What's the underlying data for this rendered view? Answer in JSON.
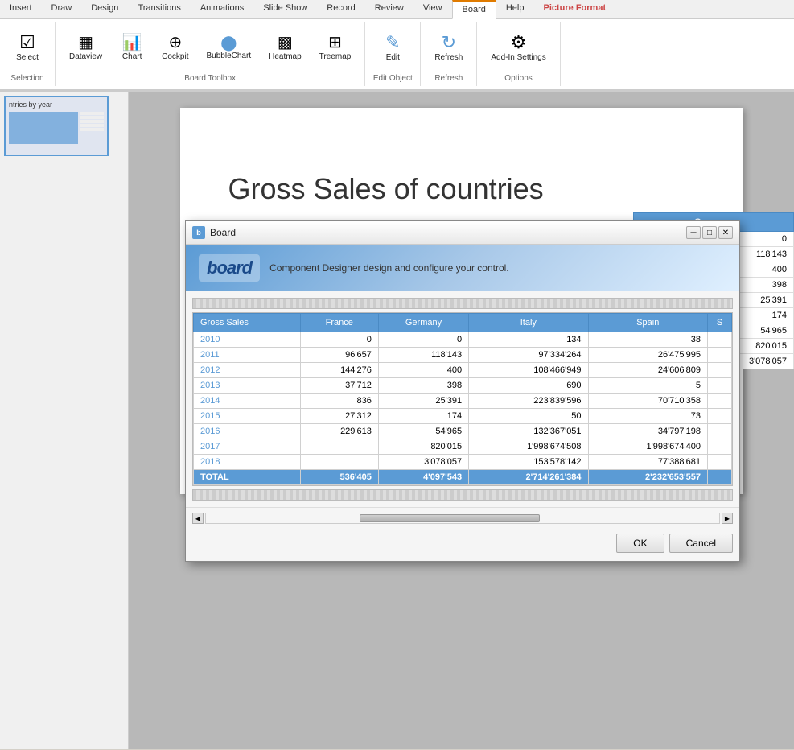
{
  "ribbon": {
    "tabs": [
      {
        "label": "Insert",
        "active": false
      },
      {
        "label": "Draw",
        "active": false
      },
      {
        "label": "Design",
        "active": false
      },
      {
        "label": "Transitions",
        "active": false
      },
      {
        "label": "Animations",
        "active": false
      },
      {
        "label": "Slide Show",
        "active": false
      },
      {
        "label": "Record",
        "active": false
      },
      {
        "label": "Review",
        "active": false
      },
      {
        "label": "View",
        "active": false
      },
      {
        "label": "Board",
        "active": true
      },
      {
        "label": "Help",
        "active": false
      },
      {
        "label": "Picture Format",
        "active": false,
        "highlight": true
      }
    ],
    "groups": {
      "selection": {
        "label": "Selection",
        "buttons": [
          {
            "label": "Select",
            "icon": "☑"
          }
        ]
      },
      "toolbox": {
        "label": "Board Toolbox",
        "buttons": [
          {
            "label": "Dataview",
            "icon": "▦"
          },
          {
            "label": "Chart",
            "icon": "📊"
          },
          {
            "label": "Cockpit",
            "icon": "⊕"
          },
          {
            "label": "BubbleChart",
            "icon": "⬤"
          },
          {
            "label": "Heatmap",
            "icon": "▩"
          },
          {
            "label": "Treemap",
            "icon": "▪"
          }
        ]
      },
      "editobject": {
        "label": "Edit Object",
        "buttons": [
          {
            "label": "Edit",
            "icon": "✎"
          }
        ]
      },
      "refresh": {
        "label": "Refresh",
        "buttons": [
          {
            "label": "Refresh",
            "icon": "↻"
          }
        ]
      },
      "options": {
        "label": "Options",
        "buttons": [
          {
            "label": "Add-In Settings",
            "icon": "⚙"
          }
        ]
      }
    }
  },
  "modal": {
    "title": "Board",
    "header_text": "Component Designer design and configure your control.",
    "logo_text": "board",
    "table": {
      "columns": [
        "Gross Sales",
        "France",
        "Germany",
        "Italy",
        "Spain",
        "S"
      ],
      "rows": [
        {
          "label": "2010",
          "france": "0",
          "germany": "0",
          "italy": "134",
          "spain": "38",
          "s": ""
        },
        {
          "label": "2011",
          "france": "96'657",
          "germany": "118'143",
          "italy": "97'334'264",
          "spain": "26'475'995",
          "s": ""
        },
        {
          "label": "2012",
          "france": "144'276",
          "germany": "400",
          "italy": "108'466'949",
          "spain": "24'606'809",
          "s": ""
        },
        {
          "label": "2013",
          "france": "37'712",
          "germany": "398",
          "italy": "690",
          "spain": "5",
          "s": ""
        },
        {
          "label": "2014",
          "france": "836",
          "germany": "25'391",
          "italy": "223'839'596",
          "spain": "70'710'358",
          "s": ""
        },
        {
          "label": "2015",
          "france": "27'312",
          "germany": "174",
          "italy": "50",
          "spain": "73",
          "s": ""
        },
        {
          "label": "2016",
          "france": "229'613",
          "germany": "54'965",
          "italy": "132'367'051",
          "spain": "34'797'198",
          "s": ""
        },
        {
          "label": "2017",
          "france": "",
          "germany": "820'015",
          "italy": "1'998'674'508",
          "spain": "1'998'674'400",
          "s": ""
        },
        {
          "label": "2018",
          "france": "",
          "germany": "3'078'057",
          "italy": "153'578'142",
          "spain": "77'388'681",
          "s": ""
        }
      ],
      "total_row": {
        "label": "TOTAL",
        "france": "536'405",
        "germany": "4'097'543",
        "italy": "2'714'261'384",
        "spain": "2'232'653'557",
        "s": ""
      }
    },
    "buttons": {
      "ok": "OK",
      "cancel": "Cancel"
    }
  },
  "slide": {
    "title": "Gross Sales of countries",
    "left_panel_label": "ntries by year"
  },
  "germany_panel": {
    "header": "Germany",
    "values": [
      "0",
      "118'143",
      "400",
      "398",
      "25'391",
      "174",
      "54'965",
      "820'015",
      "3'078'057"
    ]
  }
}
